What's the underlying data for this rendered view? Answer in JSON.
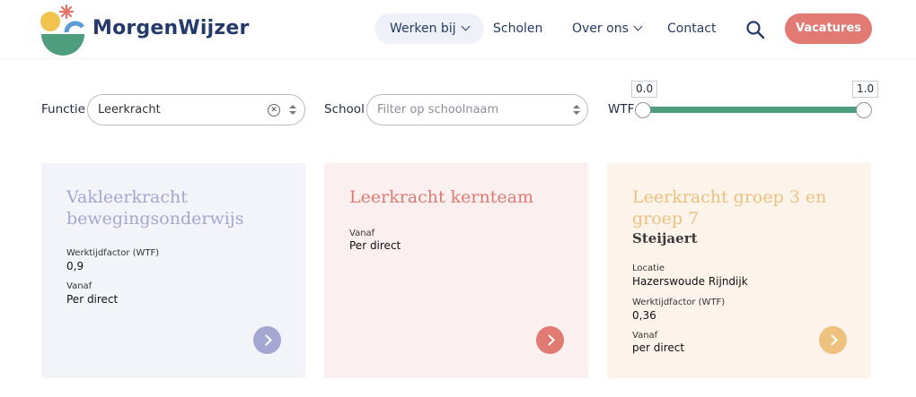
{
  "header": {
    "brand": "MorgenWijzer",
    "nav": [
      {
        "label": "Werken bij",
        "has_dropdown": true,
        "active": true
      },
      {
        "label": "Scholen",
        "has_dropdown": false
      },
      {
        "label": "Over ons",
        "has_dropdown": true
      },
      {
        "label": "Contact",
        "has_dropdown": false
      }
    ],
    "search_icon": "search-icon",
    "cta_label": "Vacatures",
    "colors": {
      "brand": "#243a6b",
      "cta": "#e07a73",
      "nav_active_bg": "#eef1f8"
    }
  },
  "filters": {
    "functie": {
      "label": "Functie",
      "value": "Leerkracht"
    },
    "school": {
      "label": "School",
      "placeholder": "Filter op schoolnaam"
    },
    "wtf": {
      "label": "WTF",
      "min": "0.0",
      "max": "1.0",
      "range_color": "#4e9d7d"
    }
  },
  "cards": [
    {
      "title": "Vakleerkracht bewegingsonderwijs",
      "subtitle": "",
      "fields": [
        {
          "key": "Werktijdfactor (WTF)",
          "value": "0,9"
        },
        {
          "key": "Vanaf",
          "value": "Per direct"
        }
      ],
      "colors": {
        "bg": "#f3f3fa",
        "title": "#a5a7d3",
        "button": "#a5a7d3"
      }
    },
    {
      "title": "Leerkracht kernteam",
      "subtitle": "",
      "fields": [
        {
          "key": "Vanaf",
          "value": "Per direct"
        }
      ],
      "colors": {
        "bg": "#fbf0ef",
        "title": "#e07a73",
        "button": "#e07a73"
      }
    },
    {
      "title": "Leerkracht groep 3 en groep 7",
      "subtitle": "Steijaert",
      "fields": [
        {
          "key": "Locatie",
          "value": "Hazerswoude Rijndijk"
        },
        {
          "key": "Werktijdfactor (WTF)",
          "value": "0,36"
        },
        {
          "key": "Vanaf",
          "value": "per direct"
        }
      ],
      "colors": {
        "bg": "#fcf3ea",
        "title": "#eec17f",
        "button": "#eec17f"
      }
    }
  ]
}
